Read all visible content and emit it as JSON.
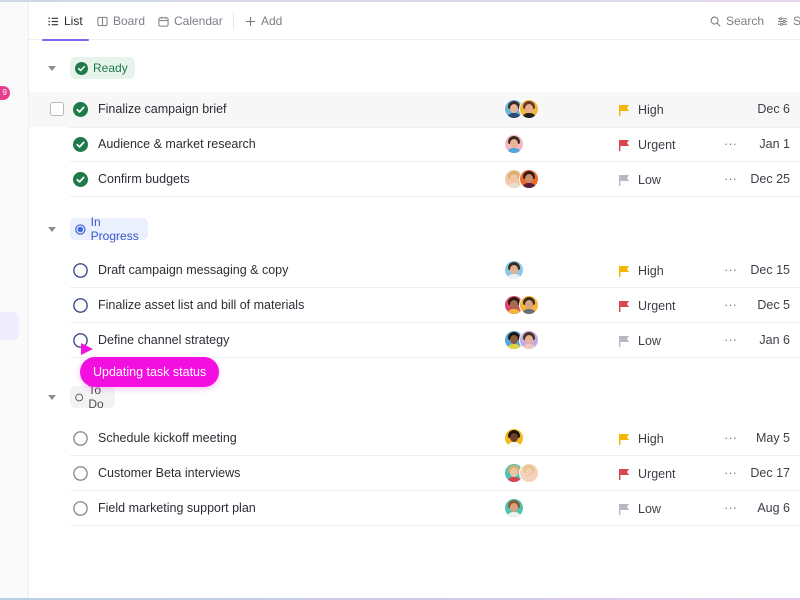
{
  "toolbar": {
    "tabs": [
      {
        "label": "List",
        "icon": "list-icon",
        "active": true
      },
      {
        "label": "Board",
        "icon": "board-icon",
        "active": false
      },
      {
        "label": "Calendar",
        "icon": "calendar-icon",
        "active": false
      }
    ],
    "add_label": "Add",
    "search_label": "Search",
    "settings_label": "S"
  },
  "sidebar": {
    "badge_count": "9"
  },
  "colors": {
    "accent": "#7b68ee",
    "ready": "#1f7a4a",
    "in_progress": "#3a57c6",
    "high": "#f5b400",
    "urgent": "#d9434b",
    "low": "#b4b8c0",
    "tooltip": "#f20fe0"
  },
  "groups": [
    {
      "label": "Ready",
      "status": "ready",
      "tasks": [
        {
          "name": "Finalize campaign brief",
          "priority": "High",
          "due": "Dec 6",
          "assignees": 2
        },
        {
          "name": "Audience & market research",
          "priority": "Urgent",
          "due": "Jan 1",
          "assignees": 1
        },
        {
          "name": "Confirm budgets",
          "priority": "Low",
          "due": "Dec 25",
          "assignees": 2
        }
      ]
    },
    {
      "label": "In Progress",
      "status": "in-progress",
      "tasks": [
        {
          "name": "Draft campaign messaging & copy",
          "priority": "High",
          "due": "Dec 15",
          "assignees": 1
        },
        {
          "name": "Finalize asset list and bill of materials",
          "priority": "Urgent",
          "due": "Dec 5",
          "assignees": 2
        },
        {
          "name": "Define channel strategy",
          "priority": "Low",
          "due": "Jan 6",
          "assignees": 2
        }
      ]
    },
    {
      "label": "To Do",
      "status": "todo",
      "tasks": [
        {
          "name": "Schedule kickoff meeting",
          "priority": "High",
          "due": "May 5",
          "assignees": 1
        },
        {
          "name": "Customer Beta interviews",
          "priority": "Urgent",
          "due": "Dec 17",
          "assignees": 2
        },
        {
          "name": "Field marketing support plan",
          "priority": "Low",
          "due": "Aug 6",
          "assignees": 1
        }
      ]
    }
  ],
  "more_label": "···",
  "tooltip": {
    "text": "Updating task status"
  }
}
